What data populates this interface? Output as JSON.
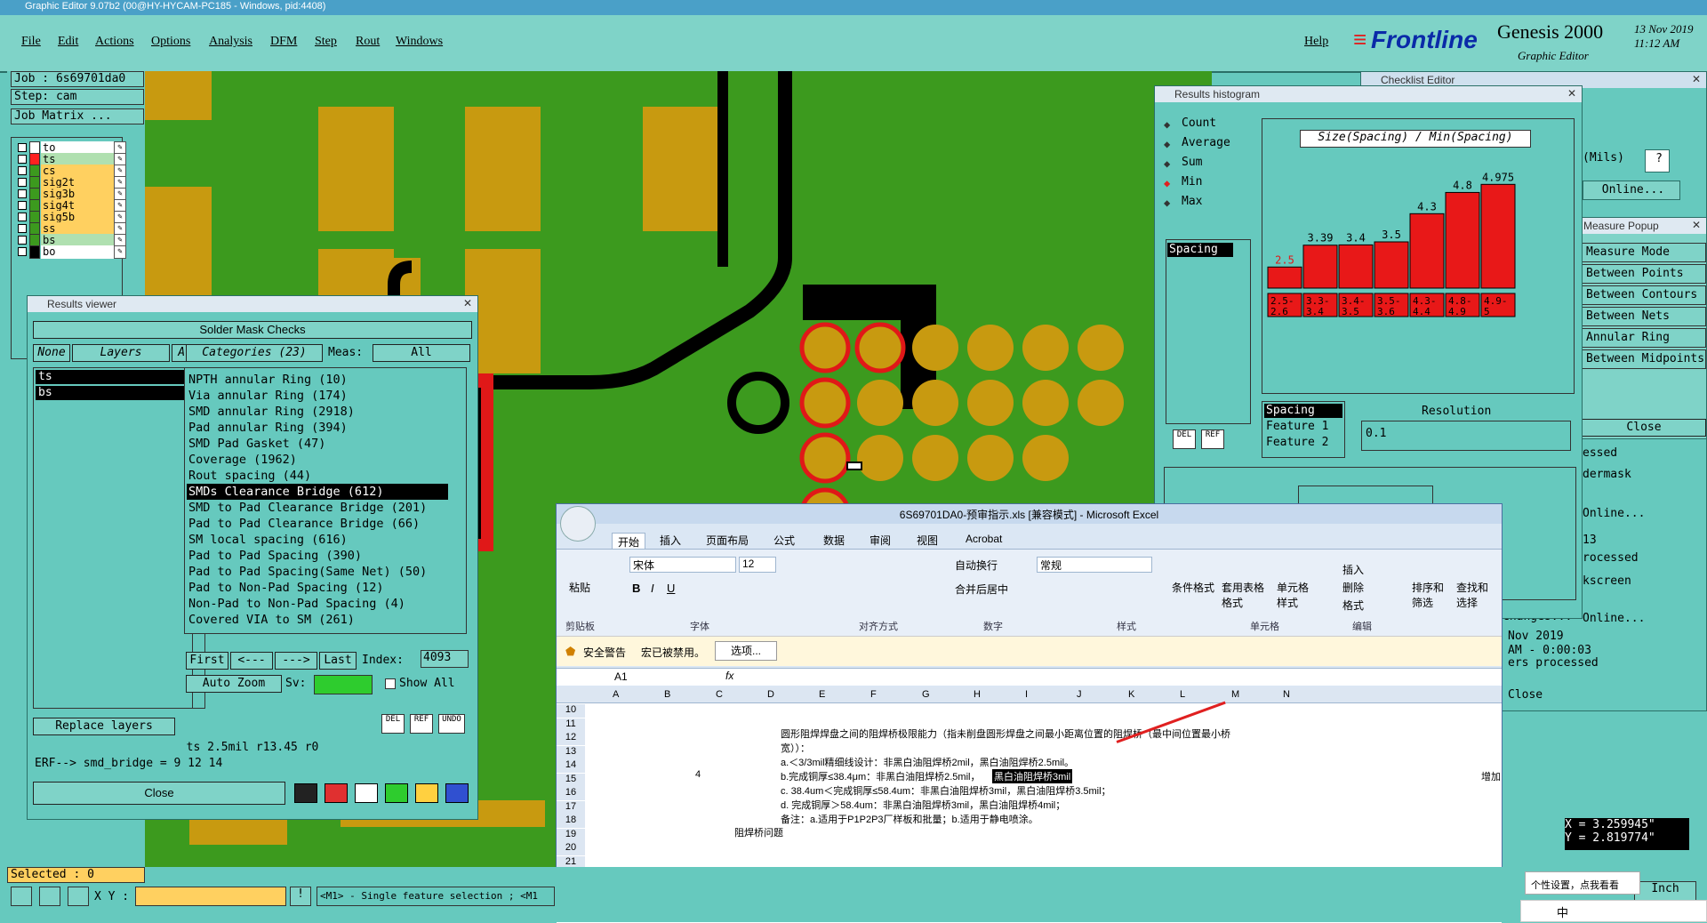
{
  "window": {
    "title": "Graphic Editor 9.07b2 (00@HY-HYCAM-PC185 - Windows, pid:4408)"
  },
  "menu": [
    "File",
    "Edit",
    "Actions",
    "Options",
    "Analysis",
    "DFM",
    "Step",
    "Rout",
    "Windows"
  ],
  "help": "Help",
  "brand": {
    "logo": "Frontline",
    "product": "Genesis 2000",
    "sub": "Graphic Editor",
    "date": "13 Nov 2019",
    "time": "11:12 AM"
  },
  "left": {
    "job": "Job : 6s69701da0",
    "step": "Step: cam",
    "matrix": "Job Matrix ...",
    "layers": [
      {
        "name": "to",
        "color": "#ffffff",
        "bg": "#ffffff"
      },
      {
        "name": "ts",
        "color": "#ff2020",
        "bg": "#b0e0b0"
      },
      {
        "name": "cs",
        "color": "#3c9a1e",
        "bg": "#ffd060"
      },
      {
        "name": "sig2t",
        "color": "#3c9a1e",
        "bg": "#ffd060"
      },
      {
        "name": "sig3b",
        "color": "#3c9a1e",
        "bg": "#ffd060"
      },
      {
        "name": "sig4t",
        "color": "#3c9a1e",
        "bg": "#ffd060"
      },
      {
        "name": "sig5b",
        "color": "#3c9a1e",
        "bg": "#ffd060"
      },
      {
        "name": "ss",
        "color": "#3c9a1e",
        "bg": "#ffd060"
      },
      {
        "name": "bs",
        "color": "#3c9a1e",
        "bg": "#b0e0b0"
      },
      {
        "name": "bo",
        "color": "#000000",
        "bg": "#ffffff"
      }
    ],
    "selected": "Selected : 0"
  },
  "results": {
    "title": "Results viewer",
    "header": "Solder Mask Checks",
    "none": "None",
    "layers": "Layers",
    "all": "All",
    "categories_label": "Categories (23)",
    "meas": "Meas:",
    "meas_val": "All",
    "layer_list": [
      "ts",
      "bs"
    ],
    "categories": [
      "NPTH annular Ring (10)",
      "Via annular Ring (174)",
      "SMD annular Ring (2918)",
      "Pad annular Ring (394)",
      "SMD Pad Gasket (47)",
      "Coverage (1962)",
      "Rout spacing (44)",
      "SMDs Clearance Bridge (612)",
      "SMD to Pad Clearance Bridge (201)",
      "Pad to Pad Clearance Bridge (66)",
      "SM local spacing (616)",
      "Pad to Pad Spacing (390)",
      "Pad to Pad Spacing(Same Net) (50)",
      "Pad to Non-Pad Spacing (12)",
      "Non-Pad to Non-Pad Spacing (4)",
      "Covered VIA to SM (261)"
    ],
    "first": "First",
    "prev": "<---",
    "next": "--->",
    "last": "Last",
    "index_label": "Index:",
    "index_val": "4093",
    "autozoom": "Auto Zoom",
    "sv": "Sv:",
    "show_all": "Show All",
    "replace": "Replace layers",
    "info": "ts 2.5mil   r13.45   r0",
    "erf": "ERF--> smd_bridge = 9 12 14",
    "close": "Close"
  },
  "histogram": {
    "title": "Results histogram",
    "modes": [
      "Count",
      "Average",
      "Sum",
      "Min",
      "Max"
    ],
    "selected_mode": "Min",
    "spacing": "Spacing",
    "label": "Size(Spacing) / Min(Spacing)",
    "chart_data": {
      "type": "bar",
      "categories": [
        "2.5-2.6",
        "3.3-3.4",
        "3.4-3.5",
        "3.5-3.6",
        "4.3-4.4",
        "4.8-4.9",
        "4.9-5"
      ],
      "values": [
        2.5,
        3.39,
        3.4,
        3.5,
        4.3,
        4.8,
        4.975
      ],
      "value_labels": [
        "2.5",
        "3.39",
        "3.4",
        "3.5",
        "4.3",
        "4.8",
        "4.975"
      ],
      "bin_labels": [
        "2.5-\n2.6",
        "3.3-\n3.4",
        "3.4-\n3.5",
        "3.5-\n3.6",
        "4.3-\n4.4",
        "4.8-\n4.9",
        "4.9-\n5"
      ]
    },
    "res_list": [
      "Spacing",
      "Feature 1",
      "Feature 2"
    ],
    "resolution": "Resolution",
    "res_val": "0.1",
    "del": "DEL",
    "ref": "REF"
  },
  "checklist": {
    "title": "Checklist Editor",
    "mils": "(Mils)",
    "online": "Online...",
    "close": "Close"
  },
  "measure": {
    "title": "Measure Popup",
    "items": [
      "Measure Mode",
      "Between Points",
      "Between Contours",
      "Between Nets",
      "Annular Ring",
      "Between Midpoints"
    ],
    "close": "Close"
  },
  "right_rows": [
    "essed",
    "dermask",
    "Online...",
    "13",
    "rocessed",
    "kscreen",
    "Online...",
    "Changes...",
    "Nov 2019",
    "AM - 0:00:03",
    "ers processed",
    "Close"
  ],
  "coords": {
    "x": "X = 3.259945\"",
    "y": "Y = 2.819774\"",
    "unit": "Inch"
  },
  "status": {
    "xy": "X Y :",
    "msg": "<M1> - Single feature selection ; <M1"
  },
  "excel": {
    "title": "6S69701DA0-预审指示.xls  [兼容模式] - Microsoft Excel",
    "tabs": [
      "开始",
      "插入",
      "页面布局",
      "公式",
      "数据",
      "审阅",
      "视图",
      "Acrobat"
    ],
    "font": "宋体",
    "size": "12",
    "wrap": "自动换行",
    "merge": "合并后居中",
    "format": "常规",
    "groups": [
      "剪贴板",
      "字体",
      "对齐方式",
      "数字",
      "样式",
      "单元格",
      "编辑"
    ],
    "insert": "插入",
    "delete": "删除",
    "fmt": "格式",
    "cond": "条件格式",
    "table": "套用表格格式",
    "cellstyle": "单元格样式",
    "sort": "排序和筛选",
    "find": "查找和选择",
    "paste": "粘贴",
    "security": "安全警告",
    "macros": "宏已被禁用。",
    "options": "选项...",
    "cellref": "A1",
    "cols": [
      "A",
      "B",
      "C",
      "D",
      "E",
      "F",
      "G",
      "H",
      "I",
      "J",
      "K",
      "L",
      "M",
      "N"
    ],
    "rows": [
      "10",
      "11",
      "12",
      "13",
      "14",
      "15",
      "16",
      "17",
      "18",
      "19",
      "20",
      "21"
    ],
    "lines": [
      "圆形阻焊焊盘之间的阻焊桥极限能力（指未削盘圆形焊盘之间最小距离位置的阻焊桥（最中间位置最小桥",
      "宽））：",
      "a.＜3/3mil精细线设计：非黑白油阻焊桥2mil，黑白油阻焊桥2.5mil。",
      "b.完成铜厚≤38.4μm：非黑白油阻焊桥2.5mil，",
      "黑白油阻焊桥3mil",
      "c.  38.4um＜完成铜厚≤58.4um：非黑白油阻焊桥3mil，黑白油阻焊桥3.5mil；",
      "d.  完成铜厚＞58.4um：非黑白油阻焊桥3mil，黑白油阻焊桥4mil；",
      "备注：a.适用于P1P2P3厂样板和批量；b.适用于静电喷涂。"
    ],
    "num4": "4",
    "trail": "增加",
    "bottom": "阻焊桥问题"
  },
  "ime": {
    "tip": "个性设置，点我看看",
    "bar": "中"
  }
}
